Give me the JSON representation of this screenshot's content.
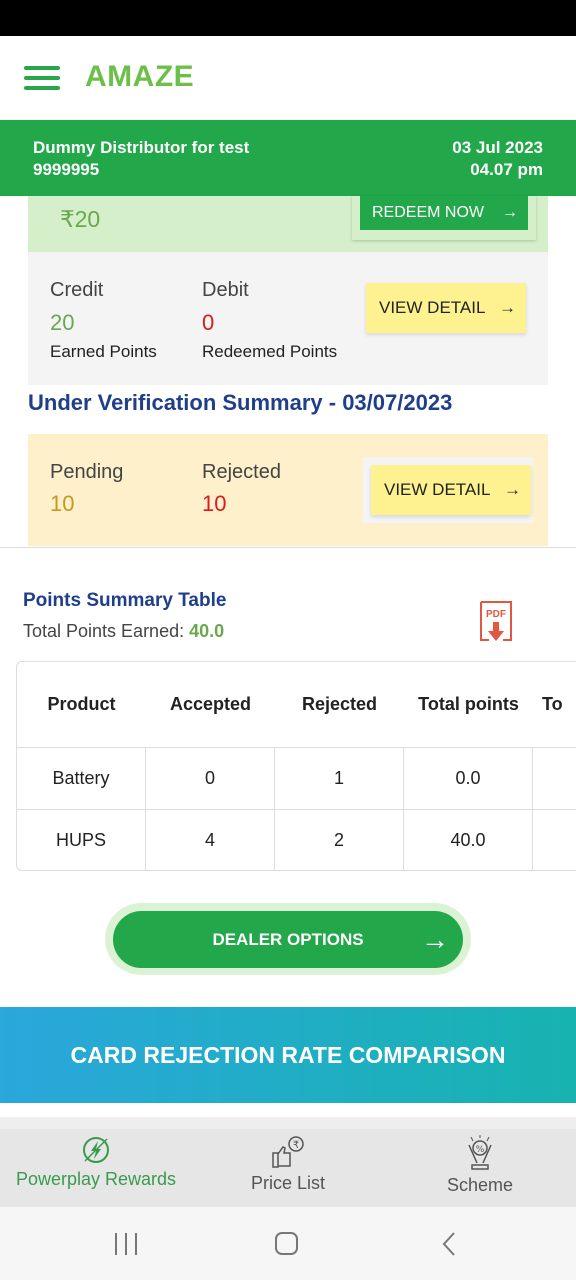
{
  "app": {
    "logo": "AMAZE",
    "menu_icon": "hamburger-icon"
  },
  "user": {
    "name": "Dummy Distributor for test",
    "id": "9999995",
    "date": "03 Jul 2023",
    "time": "04.07 pm"
  },
  "wallet": {
    "amount": "₹20",
    "redeem_label": "REDEEM NOW"
  },
  "points": {
    "credit_label": "Credit",
    "credit_value": "20",
    "credit_sub": "Earned Points",
    "debit_label": "Debit",
    "debit_value": "0",
    "debit_sub": "Redeemed Points",
    "view_detail": "VIEW DETAIL"
  },
  "verification": {
    "title": "Under Verification Summary - 03/07/2023",
    "pending_label": "Pending",
    "pending_value": "10",
    "rejected_label": "Rejected",
    "rejected_value": "10",
    "view_detail": "VIEW DETAIL"
  },
  "summary": {
    "title": "Points Summary Table",
    "total_label": "Total Points Earned:",
    "total_value": "40.0",
    "pdf_label": "PDF",
    "columns": [
      "Product",
      "Accepted",
      "Rejected",
      "Total points",
      "To"
    ],
    "rows": [
      [
        "Battery",
        "0",
        "1",
        "0.0",
        ""
      ],
      [
        "HUPS",
        "4",
        "2",
        "40.0",
        ""
      ]
    ]
  },
  "dealer_button": "DEALER OPTIONS",
  "banner": "CARD REJECTION RATE COMPARISON",
  "bottom_nav": [
    {
      "label": "Powerplay Rewards",
      "icon": "powerplay-icon",
      "active": true
    },
    {
      "label": "Price List",
      "icon": "thumbs-up-rupee-icon",
      "active": false
    },
    {
      "label": "Scheme",
      "icon": "scheme-trophy-icon",
      "active": false
    }
  ],
  "colors": {
    "brand_green": "#22a84a",
    "logo_green": "#6cc04a",
    "title_blue": "#203f8a",
    "debit_red": "#d81b1b",
    "pending_gold": "#c39a1c"
  }
}
